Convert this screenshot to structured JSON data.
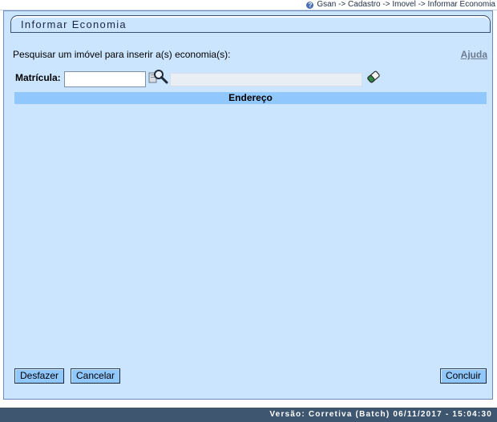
{
  "breadcrumb": {
    "text": "Gsan -> Cadastro -> Imovel -> Informar Economia"
  },
  "page": {
    "title": "Informar Economia"
  },
  "form": {
    "instruction": "Pesquisar um imóvel para inserir a(s) economia(s):",
    "help_label": "Ajuda",
    "matricula_label": "Matrícula:",
    "matricula_value": "",
    "description_value": ""
  },
  "table": {
    "header": "Endereço"
  },
  "buttons": {
    "undo": "Desfazer",
    "cancel": "Cancelar",
    "finish": "Concluir"
  },
  "footer": {
    "version": "Versão: Corretiva (Batch) 06/11/2017 - 15:04:30"
  },
  "colors": {
    "panel_background": "#cbe5ff",
    "header_row": "#90c7fc",
    "footer": "#3e5670"
  },
  "icons": [
    "help-icon",
    "search-icon",
    "eraser-icon"
  ]
}
